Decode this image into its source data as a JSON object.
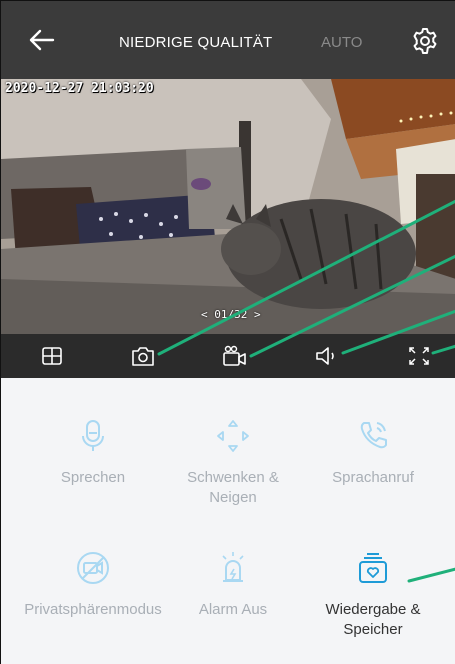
{
  "topbar": {
    "back_icon": "arrow-left-icon",
    "quality_label": "NIEDRIGE QUALITÄT",
    "auto_label": "AUTO",
    "settings_icon": "gear-icon"
  },
  "video": {
    "timestamp": "2020-12-27 21:03:20",
    "pager": "< 01/32 >"
  },
  "controls": [
    {
      "name": "grid-view-icon"
    },
    {
      "name": "camera-snapshot-icon"
    },
    {
      "name": "video-record-icon"
    },
    {
      "name": "speaker-icon"
    },
    {
      "name": "fullscreen-icon"
    }
  ],
  "features": [
    {
      "label": "Sprechen",
      "icon": "microphone-icon"
    },
    {
      "label": "Schwenken & Neigen",
      "icon": "pan-tilt-icon"
    },
    {
      "label": "Sprachanruf",
      "icon": "phone-call-icon"
    },
    {
      "label": "Privatsphärenmodus",
      "icon": "privacy-camera-off-icon"
    },
    {
      "label": "Alarm Aus",
      "icon": "alarm-siren-icon"
    },
    {
      "label": "Wiedergabe & Speicher",
      "icon": "playback-storage-icon"
    }
  ],
  "colors": {
    "topbar": "#3b3b3b",
    "controls": "#2b2b2b",
    "icon_disabled": "#a9d8f2",
    "icon_active": "#1e9bd7",
    "callout": "#1fb07a"
  }
}
